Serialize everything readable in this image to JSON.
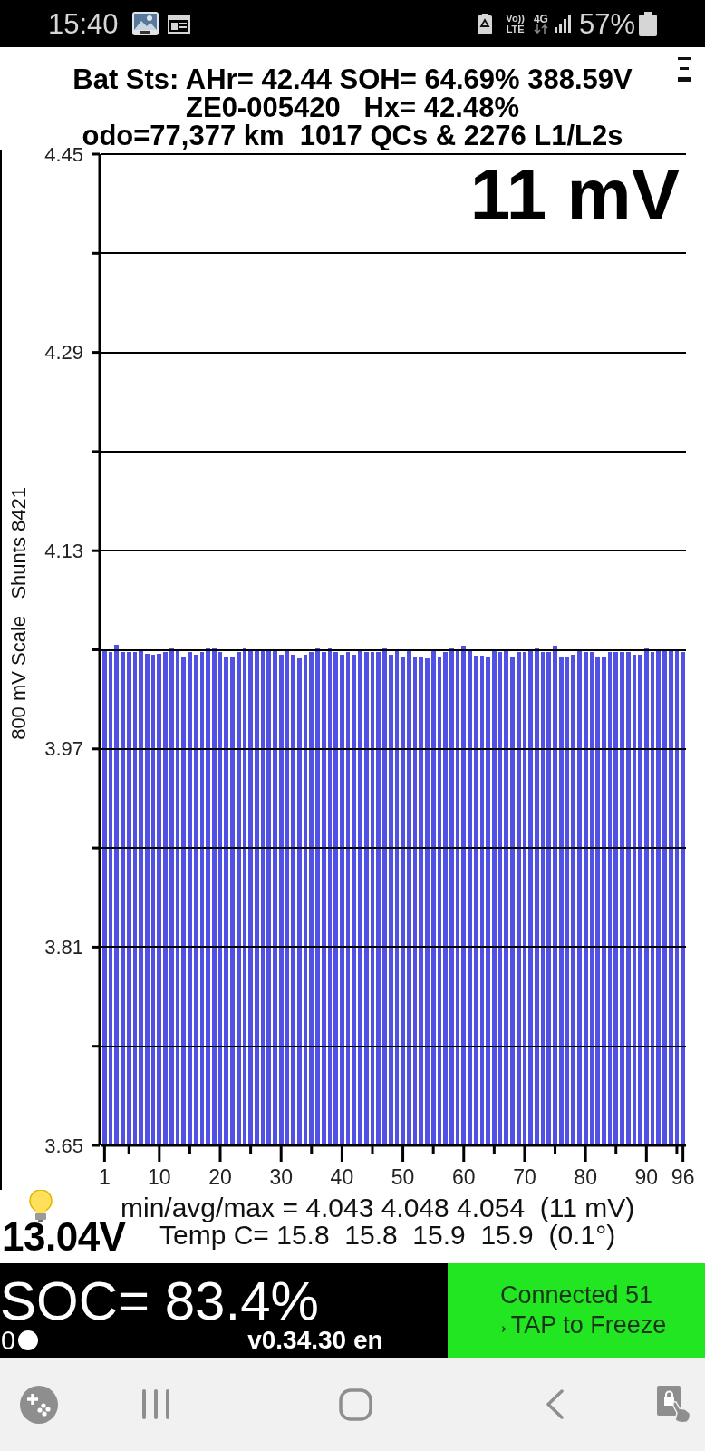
{
  "status_bar": {
    "time": "15:40",
    "network": {
      "top": "Vo))",
      "bottom": "LTE"
    },
    "data_type": "4G",
    "battery": "57%"
  },
  "header": {
    "lines": [
      "Bat Sts: AHr= 42.44 SOH= 64.69% 388.59V",
      "ZE0-005420   Hx= 42.48%",
      "odo=77,377 km  1017 QCs & 2276 L1/L2s"
    ]
  },
  "chart": {
    "spread": "11 mV",
    "chart_data": {
      "type": "bar",
      "ylabel": "800 mV Scale   Shunts 8421",
      "x": [
        1,
        2,
        3,
        4,
        5,
        6,
        7,
        8,
        9,
        10,
        11,
        12,
        13,
        14,
        15,
        16,
        17,
        18,
        19,
        20,
        21,
        22,
        23,
        24,
        25,
        26,
        27,
        28,
        29,
        30,
        31,
        32,
        33,
        34,
        35,
        36,
        37,
        38,
        39,
        40,
        41,
        42,
        43,
        44,
        45,
        46,
        47,
        48,
        49,
        50,
        51,
        52,
        53,
        54,
        55,
        56,
        57,
        58,
        59,
        60,
        61,
        62,
        63,
        64,
        65,
        66,
        67,
        68,
        69,
        70,
        71,
        72,
        73,
        74,
        75,
        76,
        77,
        78,
        79,
        80,
        81,
        82,
        83,
        84,
        85,
        86,
        87,
        88,
        89,
        90,
        91,
        92,
        93,
        94,
        95,
        96
      ],
      "series": [
        {
          "color": "#5151e6",
          "values": [
            4.05,
            4.048,
            4.054,
            4.048,
            4.048,
            4.048,
            4.049,
            4.047,
            4.046,
            4.047,
            4.048,
            4.052,
            4.049,
            4.044,
            4.048,
            4.046,
            4.048,
            4.051,
            4.052,
            4.048,
            4.044,
            4.044,
            4.048,
            4.052,
            4.049,
            4.049,
            4.049,
            4.049,
            4.049,
            4.046,
            4.049,
            4.046,
            4.043,
            4.046,
            4.048,
            4.051,
            4.048,
            4.051,
            4.048,
            4.046,
            4.048,
            4.046,
            4.049,
            4.048,
            4.048,
            4.048,
            4.052,
            4.046,
            4.049,
            4.044,
            4.049,
            4.044,
            4.044,
            4.043,
            4.049,
            4.044,
            4.048,
            4.051,
            4.049,
            4.053,
            4.049,
            4.045,
            4.045,
            4.044,
            4.049,
            4.048,
            4.049,
            4.044,
            4.048,
            4.048,
            4.049,
            4.051,
            4.048,
            4.048,
            4.053,
            4.044,
            4.044,
            4.046,
            4.049,
            4.048,
            4.048,
            4.044,
            4.044,
            4.048,
            4.048,
            4.048,
            4.048,
            4.046,
            4.046,
            4.051,
            4.048,
            4.049,
            4.049,
            4.049,
            4.049,
            4.048
          ]
        }
      ],
      "xlim": [
        0.5,
        96.5
      ],
      "ylim": [
        3.65,
        4.45
      ],
      "xticks": [
        1,
        10,
        20,
        30,
        40,
        50,
        60,
        70,
        80,
        90,
        96
      ],
      "yticks": [
        3.65,
        3.81,
        3.97,
        4.13,
        4.29,
        4.45
      ],
      "grid": true
    }
  },
  "stats": {
    "min_avg_max": "min/avg/max = 4.043 4.048 4.054  (11 mV)",
    "aux_voltage": "13.04V",
    "temperature": "Temp C= 15.8  15.8  15.9  15.9  (0.1°)"
  },
  "footer": {
    "soc": "SOC= 83.4%",
    "counter": "0",
    "version": "v0.34.30 en",
    "connection": [
      "Connected 51",
      "→TAP to Freeze"
    ]
  }
}
